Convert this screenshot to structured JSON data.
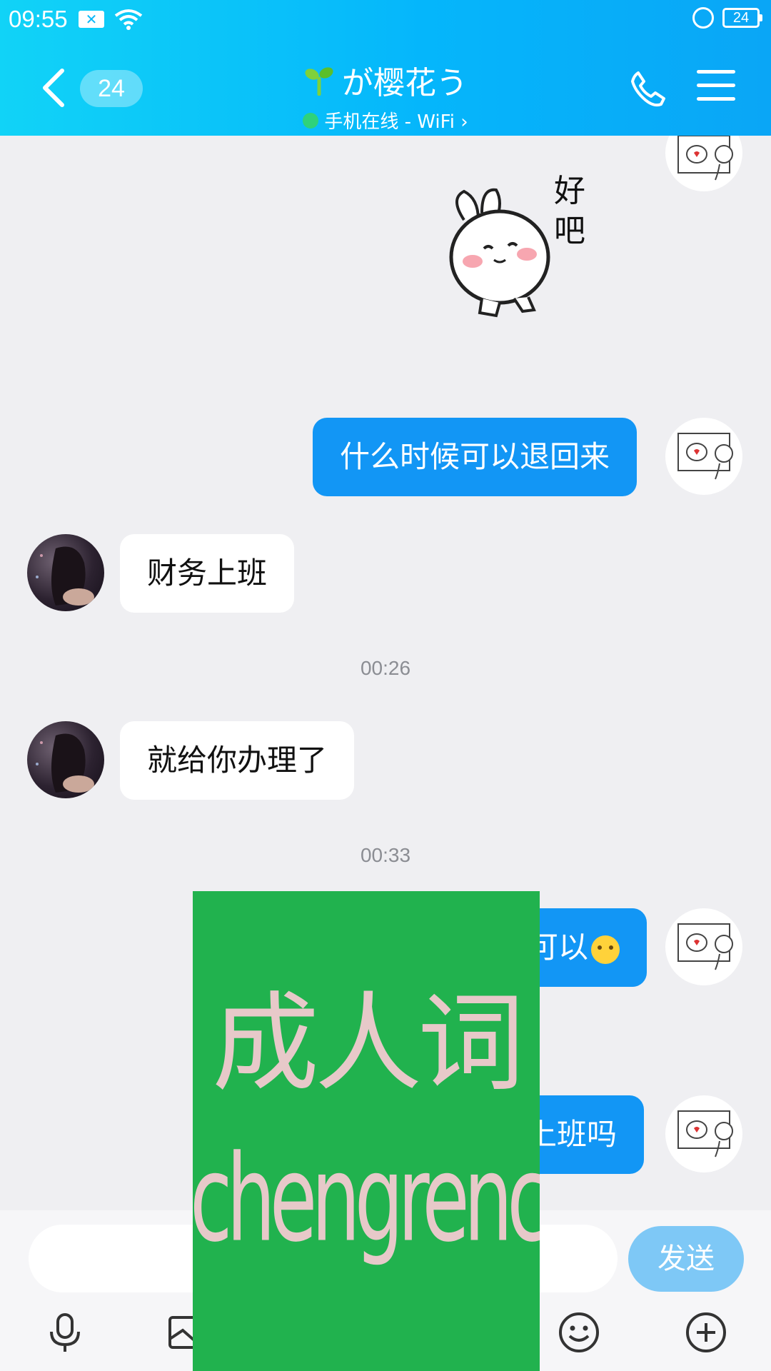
{
  "status_bar": {
    "time": "09:55",
    "battery": "24"
  },
  "header": {
    "unread_count": "24",
    "contact_name": "が樱花う",
    "contact_status": "手机在线 - WiFi ›"
  },
  "messages": [
    {
      "from": "me",
      "type": "sticker",
      "text": "好\n吧"
    },
    {
      "from": "me",
      "type": "text",
      "text": "什么时候可以退回来"
    },
    {
      "from": "friend",
      "type": "text",
      "text": "财务上班"
    },
    {
      "type": "time",
      "text": "00:26"
    },
    {
      "from": "friend",
      "type": "text",
      "text": "就给你办理了"
    },
    {
      "type": "time",
      "text": "00:33"
    },
    {
      "from": "me",
      "type": "text",
      "text": "可以"
    },
    {
      "from": "me",
      "type": "text",
      "text": "上班吗"
    }
  ],
  "input": {
    "placeholder": "",
    "send_label": "发送"
  },
  "toolbar": [
    "mic-icon",
    "picture-icon",
    "emoji-icon",
    "plus-icon"
  ],
  "overlay": {
    "line1": "成人词",
    "line2": "chengrenci.com",
    "color": "#21b24e"
  },
  "colors": {
    "header": "#05b6fb",
    "my_bubble": "#1296f5",
    "send_button": "#7ec8f6",
    "background": "#efeff2"
  }
}
